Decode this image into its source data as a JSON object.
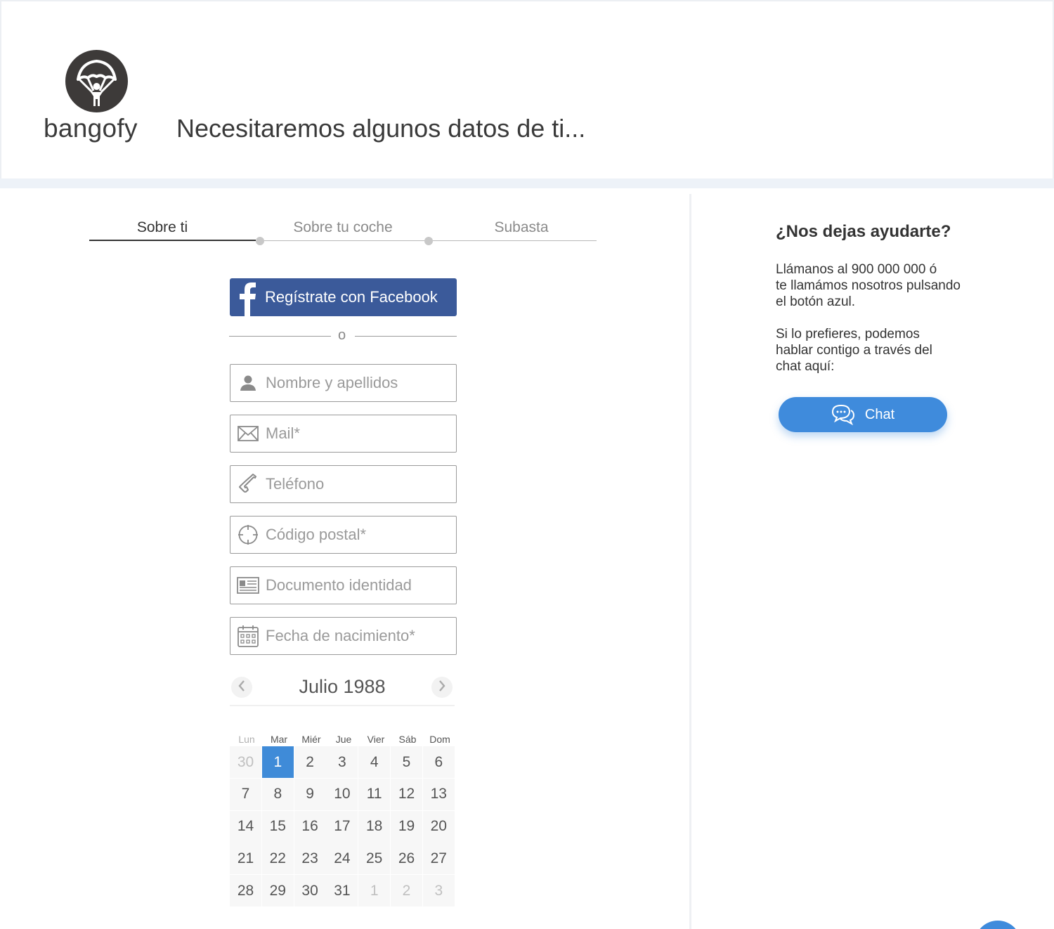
{
  "brand": {
    "name": "bangofy"
  },
  "header": {
    "title": "Necesitaremos algunos datos de ti..."
  },
  "steps": [
    {
      "label": "Sobre ti",
      "active": true
    },
    {
      "label": "Sobre tu coche",
      "active": false
    },
    {
      "label": "Subasta",
      "active": false
    }
  ],
  "facebook": {
    "label": "Regístrate con Facebook"
  },
  "separator": {
    "text": "o"
  },
  "fields": {
    "name": {
      "placeholder": "Nombre y apellidos",
      "value": ""
    },
    "mail": {
      "placeholder": "Mail*",
      "value": ""
    },
    "phone": {
      "placeholder": "Teléfono",
      "value": ""
    },
    "postal": {
      "placeholder": "Código postal*",
      "value": ""
    },
    "document": {
      "placeholder": "Documento identidad",
      "value": ""
    },
    "birthdate": {
      "placeholder": "Fecha de nacimiento*",
      "value": ""
    }
  },
  "calendar": {
    "title": "Julio 1988",
    "weekdays": [
      "Lun",
      "Mar",
      "Miér",
      "Jue",
      "Vier",
      "Sáb",
      "Dom"
    ],
    "weeks": [
      [
        "30",
        "1",
        "2",
        "3",
        "4",
        "5",
        "6"
      ],
      [
        "7",
        "8",
        "9",
        "10",
        "11",
        "12",
        "13"
      ],
      [
        "14",
        "15",
        "16",
        "17",
        "18",
        "19",
        "20"
      ],
      [
        "21",
        "22",
        "23",
        "24",
        "25",
        "26",
        "27"
      ],
      [
        "28",
        "29",
        "30",
        "31",
        "1",
        "2",
        "3"
      ]
    ],
    "selected_day": "1"
  },
  "help": {
    "title": "¿Nos dejas ayudarte?",
    "paragraph1_lines": [
      "Llámanos al 900 000 000 ó",
      "te llamámos nosotros pulsando",
      "el botón azul."
    ],
    "paragraph2_lines": [
      "Si lo prefieres, podemos",
      "hablar contigo a través del",
      "chat aquí:"
    ],
    "chat_label": "Chat"
  },
  "colors": {
    "facebook": "#3b5a9a",
    "accent": "#3f8bdc",
    "selected_day": "#3f8bd8",
    "logo": "#3d3a39"
  },
  "icons": {
    "logo": "parachute-icon",
    "facebook": "facebook-icon",
    "name": "user-icon",
    "mail": "envelope-icon",
    "phone": "phone-icon",
    "postal": "crosshair-icon",
    "document": "id-card-icon",
    "birthdate": "calendar-icon",
    "prev": "chevron-left-icon",
    "next": "chevron-right-icon",
    "chat": "chat-bubbles-icon"
  }
}
